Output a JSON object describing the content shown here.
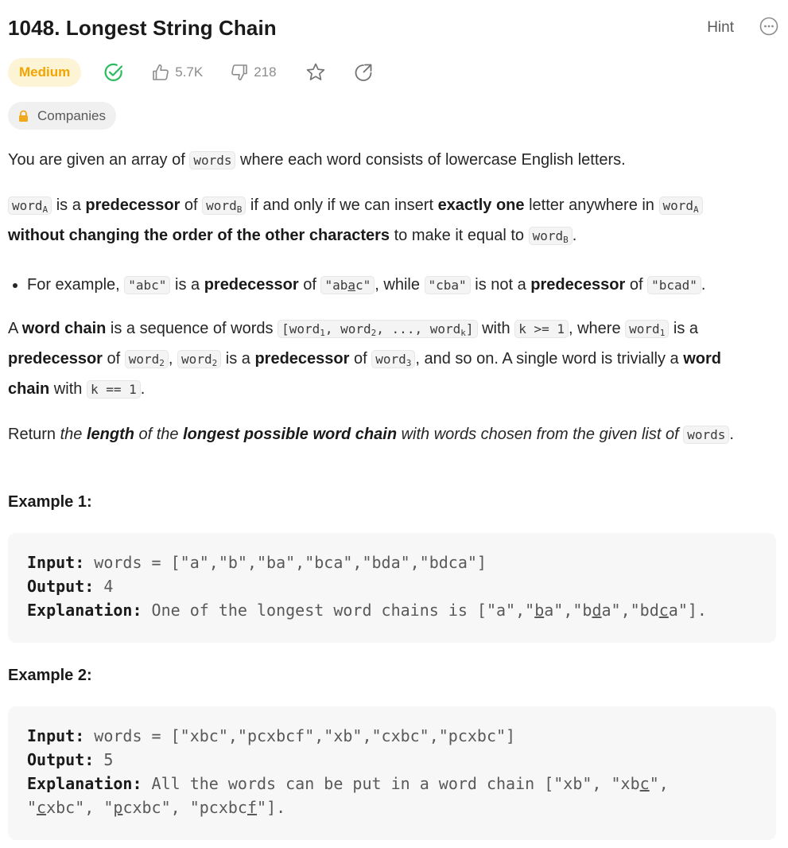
{
  "header": {
    "title": "1048. Longest String Chain",
    "hint_label": "Hint"
  },
  "meta": {
    "difficulty": "Medium",
    "likes": "5.7K",
    "dislikes": "218",
    "companies_label": "Companies",
    "colors": {
      "medium_text": "#f2a500",
      "medium_bg": "#fdf3d5",
      "solved": "#2cbb5d"
    },
    "icons": [
      "check-circle-icon",
      "thumbs-up-icon",
      "thumbs-down-icon",
      "star-icon",
      "share-icon",
      "lock-icon",
      "more-icon"
    ]
  },
  "description": {
    "p1_before": "You are given an array of ",
    "p1_code": "words",
    "p1_after": " where each word consists of lowercase English letters.",
    "p2": {
      "wordA": "word",
      "subA": "A",
      "t1": " is a ",
      "pred": "predecessor",
      "t2": " of ",
      "wordB": "word",
      "subB": "B",
      "t3": " if and only if we can insert ",
      "exact": "exactly one",
      "t4": " letter anywhere in ",
      "bold_without": "without changing the order of the other characters",
      "t5": " to make it equal to ",
      "t6": "."
    },
    "bullet": {
      "t1": "For example, ",
      "c1": "\"abc\"",
      "t2": " is a ",
      "pred": "predecessor",
      "t3": " of ",
      "c2a": "\"ab",
      "c2u": "a",
      "c2b": "c\"",
      "t4": ", while ",
      "c3": "\"cba\"",
      "t5": " is not a ",
      "t6": " of ",
      "c4": "\"bcad\"",
      "t7": "."
    },
    "p3": {
      "t1": "A ",
      "wordchain": "word chain",
      "t2": " is a sequence of words ",
      "c_seq_1": "[word",
      "s1": "1",
      "c_seq_2": ", word",
      "s2": "2",
      "c_seq_3": ", ..., word",
      "sk": "k",
      "c_seq_4": "]",
      "t3": " with ",
      "c_k": "k >= 1",
      "t4": ", where ",
      "w": "word",
      "t5": " is a ",
      "t6": " of ",
      "t7": ", ",
      "t8": " is a ",
      "t9": " of ",
      "s3": "3",
      "t10": ", and so on. A single word is trivially a ",
      "t11": " with ",
      "c_k1": "k == 1",
      "t12": "."
    },
    "p4": {
      "t1": "Return ",
      "t2": "the ",
      "b1": "length",
      "t3": " of the ",
      "b2": "longest possible word chain",
      "t4": " with words chosen from the given list of ",
      "code": "words",
      "t5": "."
    }
  },
  "examples": [
    {
      "title": "Example 1:",
      "input_label": "Input:",
      "input_value": " words = [\"a\",\"b\",\"ba\",\"bca\",\"bda\",\"bdca\"]",
      "output_label": "Output:",
      "output_value": " 4",
      "expl_label": "Explanation:",
      "expl_parts": [
        " One of the longest word chains is [\"a\",\"",
        "b",
        "a\",\"b",
        "d",
        "a\",\"bd",
        "c",
        "a\"]."
      ]
    },
    {
      "title": "Example 2:",
      "input_label": "Input:",
      "input_value": " words = [\"xbc\",\"pcxbcf\",\"xb\",\"cxbc\",\"pcxbc\"]",
      "output_label": "Output:",
      "output_value": " 5",
      "expl_label": "Explanation:",
      "expl_line1_parts": [
        " All the words can be put in a word chain [\"xb\", \"xb",
        "c",
        "\","
      ],
      "expl_line2_parts": [
        "\"",
        "c",
        "xbc\", \"",
        "p",
        "cxbc\", \"pcxbc",
        "f",
        "\"]."
      ]
    }
  ]
}
